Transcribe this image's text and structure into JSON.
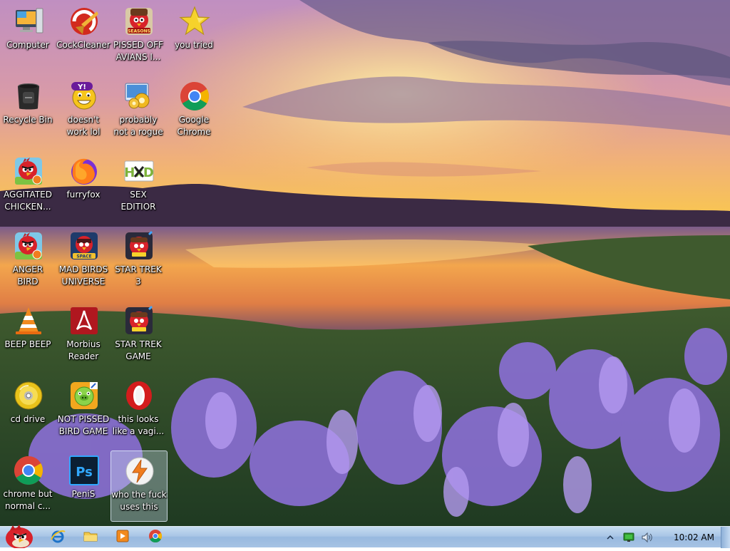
{
  "desktop": {
    "icons": [
      {
        "id": "computer",
        "label": "Computer",
        "icon": "computer-icon"
      },
      {
        "id": "cockcleaner",
        "label": "CockCleaner",
        "icon": "ccleaner-icon"
      },
      {
        "id": "pissed-off-avians",
        "label": "PISSED OFF\nAVIANS I...",
        "icon": "angry-birds-seasons-icon",
        "badge": "SEASONS"
      },
      {
        "id": "you-tried",
        "label": "you tried",
        "icon": "gold-star-icon"
      },
      {
        "id": "recycle-bin",
        "label": "Recycle Bin",
        "icon": "recycle-bin-icon"
      },
      {
        "id": "doesnt-work",
        "label": "doesn't\nwork lol",
        "icon": "yahoo-messenger-icon",
        "badge": "Y!"
      },
      {
        "id": "probably-not-a-rogue",
        "label": "probably\nnot a rogue",
        "icon": "system-gears-icon"
      },
      {
        "id": "google-chrome",
        "label": "Google\nChrome",
        "icon": "chrome-icon"
      },
      {
        "id": "aggitated-chicken",
        "label": "AGGITATED\nCHICKEN...",
        "icon": "angry-birds-icon"
      },
      {
        "id": "furryfox",
        "label": "furryfox",
        "icon": "firefox-icon"
      },
      {
        "id": "sex-editior",
        "label": "SEX\nEDITIOR",
        "icon": "hxd-hex-editor-icon",
        "badge": "HxD"
      },
      {
        "id": "anger-bird",
        "label": "ANGER\nBIRD",
        "icon": "angry-birds-icon"
      },
      {
        "id": "mad-birds-universe",
        "label": "MAD BIRDS\nUNIVERSE",
        "icon": "angry-birds-space-icon",
        "badge": "SPACE"
      },
      {
        "id": "star-trek-3",
        "label": "STAR TREK\n3",
        "icon": "angry-birds-star-wars-icon"
      },
      {
        "id": "beep-beep",
        "label": "BEEP BEEP",
        "icon": "vlc-cone-icon"
      },
      {
        "id": "morbius-reader",
        "label": "Morbius\nReader",
        "icon": "adobe-reader-icon"
      },
      {
        "id": "star-trek-game",
        "label": "STAR TREK\nGAME",
        "icon": "angry-birds-star-wars-icon"
      },
      {
        "id": "cd-drive",
        "label": "cd drive",
        "icon": "cd-disc-icon"
      },
      {
        "id": "not-pissed-bird-game",
        "label": "NOT PISSED\nBIRD GAME",
        "icon": "bad-piggies-icon"
      },
      {
        "id": "this-looks-like",
        "label": "this looks\nlike a vagi...",
        "icon": "opera-icon"
      },
      {
        "id": "chrome-but-normal",
        "label": "chrome but\nnormal c...",
        "icon": "chrome-icon"
      },
      {
        "id": "penis",
        "label": "PeniS",
        "icon": "photoshop-icon",
        "badge": "Ps"
      },
      {
        "id": "who-uses-this",
        "label": "who the fuck\nuses this",
        "icon": "lightning-browser-icon",
        "selected": true
      }
    ]
  },
  "taskbar": {
    "start_icon": "angry-bird-start-orb-icon",
    "pinned": [
      {
        "id": "ie",
        "icon": "internet-explorer-icon"
      },
      {
        "id": "explorer",
        "icon": "folder-icon"
      },
      {
        "id": "media-player",
        "icon": "media-player-icon"
      },
      {
        "id": "chrome",
        "icon": "chrome-icon"
      }
    ],
    "tray": {
      "icons": [
        "show-hidden-icons-chevron-icon",
        "network-icon",
        "volume-icon"
      ],
      "clock": "10:02 AM"
    }
  },
  "colors": {
    "taskbar": "#a9c6e6",
    "icon_label": "#ffffff"
  }
}
